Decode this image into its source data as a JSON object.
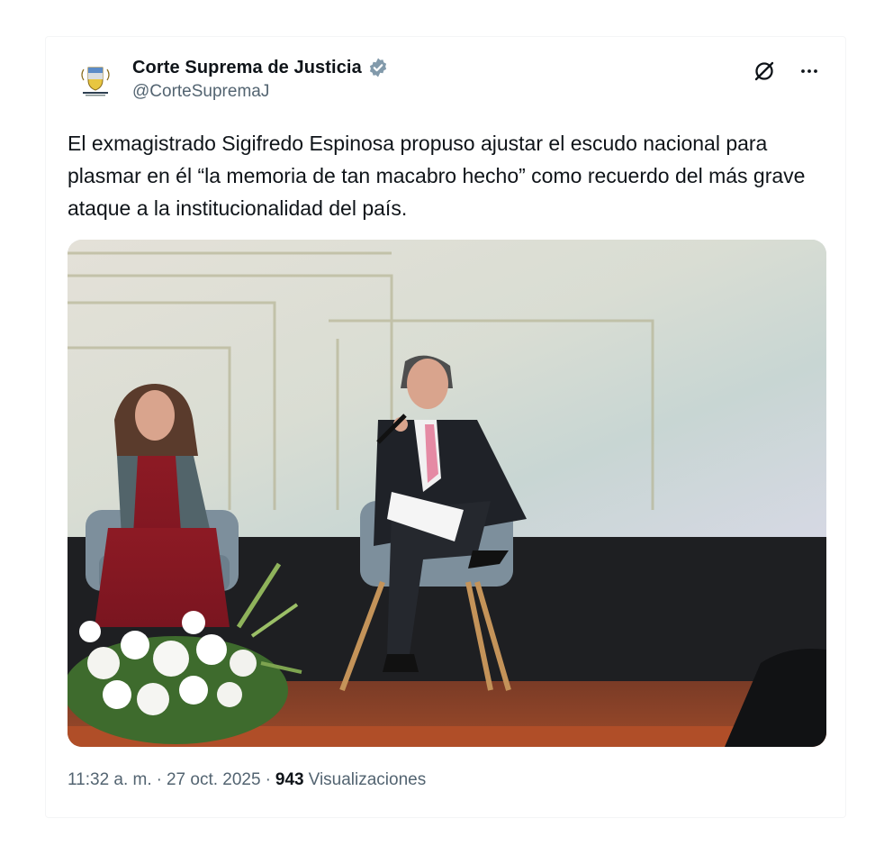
{
  "account": {
    "display_name": "Corte Suprema de Justicia",
    "handle": "@CorteSupremaJ",
    "verified_icon": "verified-badge-icon",
    "verified_color": "#829aab"
  },
  "actions": {
    "grok_icon": "grok-icon",
    "more_icon": "more-icon"
  },
  "tweet": {
    "text": "El exmagistrado Sigifredo Espinosa propuso ajustar el escudo nacional para plasmar en él “la memoria de tan macabro hecho” como recuerdo del más grave ataque a la institucionalidad del país.",
    "media_alt": "photo-two-people-seated-on-stage"
  },
  "meta": {
    "time": "11:32 a. m.",
    "separator": "·",
    "date": "27 oct. 2025",
    "views_count": "943",
    "views_label": "Visualizaciones"
  },
  "colors": {
    "text_primary": "#0f1419",
    "text_secondary": "#536471"
  }
}
